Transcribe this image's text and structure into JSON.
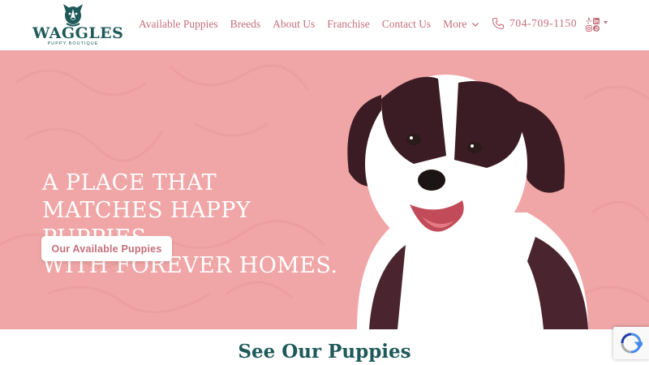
{
  "brand": {
    "logo_word": "WAGGLES",
    "logo_sub": "PUPPY BOUTIQUE"
  },
  "nav": {
    "items": [
      {
        "label": "Available Puppies"
      },
      {
        "label": "Breeds"
      },
      {
        "label": "About Us"
      },
      {
        "label": "Franchise"
      },
      {
        "label": "Contact Us"
      }
    ],
    "more_label": "More"
  },
  "phone": "704-709-1150",
  "social_icons": [
    "yelp-icon",
    "linkedin-icon",
    "instagram-icon",
    "pinterest-icon"
  ],
  "hero": {
    "headline_lines": [
      "A PLACE THAT",
      "MATCHES HAPPY",
      "PUPPIES",
      "WITH FOREVER HOMES."
    ],
    "button_label": "Our Available Puppies",
    "background_color": "#f0a6a6"
  },
  "section": {
    "title": "See Our Puppies"
  },
  "colors": {
    "accent": "#c46f7b",
    "brand_teal": "#1f5a5a"
  }
}
